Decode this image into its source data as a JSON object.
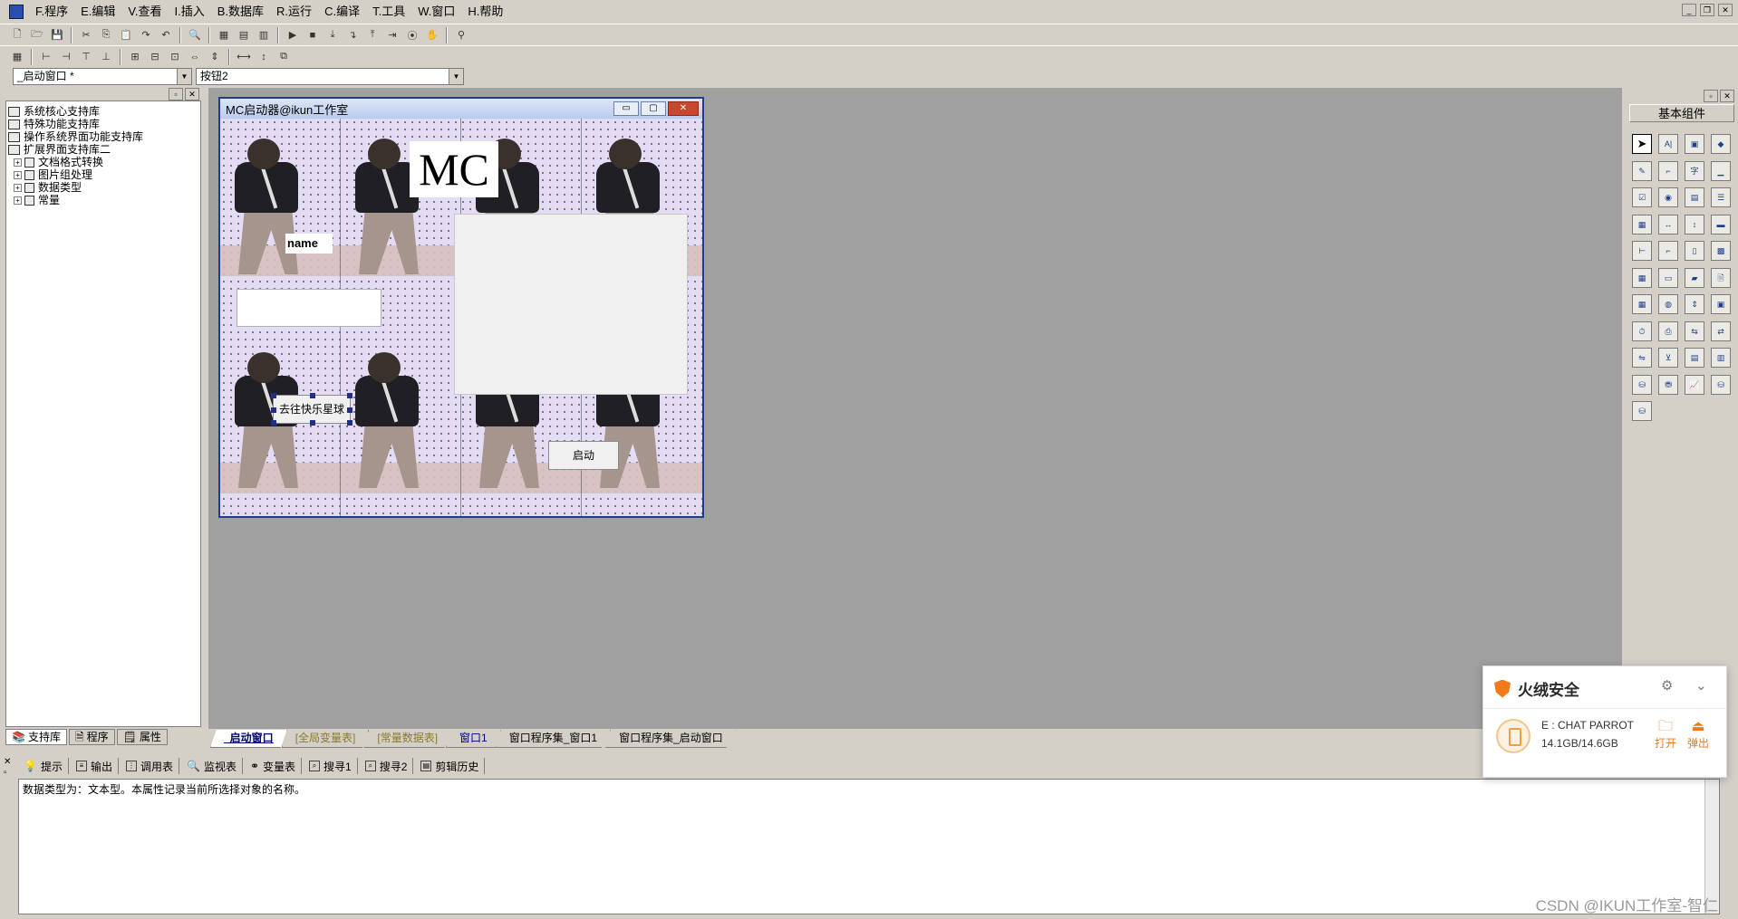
{
  "menu": [
    "F.程序",
    "E.编辑",
    "V.查看",
    "I.插入",
    "B.数据库",
    "R.运行",
    "C.编译",
    "T.工具",
    "W.窗口",
    "H.帮助"
  ],
  "combos": {
    "window_select": "_启动窗口 *",
    "component_select": "按钮2"
  },
  "library_tree": {
    "items": [
      "系统核心支持库",
      "特殊功能支持库",
      "操作系统界面功能支持库",
      "扩展界面支持库二"
    ],
    "children": [
      "文档格式转换",
      "图片组处理",
      "数据类型",
      "常量"
    ]
  },
  "left_tabs": [
    "支持库",
    "程序",
    "属性"
  ],
  "form": {
    "title": "MC启动器@ikun工作室",
    "mc_label": "MC",
    "name_label": "name",
    "go_button": "去往快乐星球",
    "start_button": "启动"
  },
  "components_title": "基本组件",
  "editor_tabs": [
    "_启动窗口",
    "[全局变量表]",
    "[常量数据表]",
    "窗口1",
    "窗口程序集_窗口1",
    "窗口程序集_启动窗口"
  ],
  "bottom_tabs": [
    "提示",
    "输出",
    "调用表",
    "监视表",
    "变量表",
    "搜寻1",
    "搜寻2",
    "剪辑历史"
  ],
  "output_text": "数据类型为：文本型。本属性记录当前所选择对象的名称。",
  "notification": {
    "brand": "火绒安全",
    "drive_name": "E : CHAT PARROT",
    "drive_size": "14.1GB/14.6GB",
    "open_label": "打开",
    "eject_label": "弹出"
  },
  "watermark": "CSDN @IKUN工作室-智仁",
  "colors": {
    "workspace": "#a0a0a0",
    "title_bar": "#1c3f8f",
    "brand_orange": "#f07a1a"
  }
}
